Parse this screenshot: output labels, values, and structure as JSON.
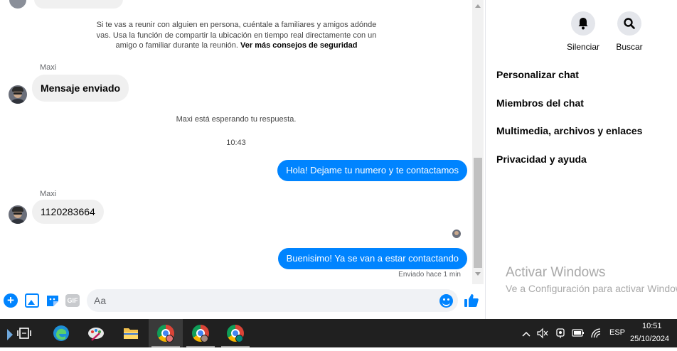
{
  "chat": {
    "safety_notice": "Si te vas a reunir con alguien en persona, cuéntale a familiares y amigos adónde vas. Usa la función de compartir la ubicación en tiempo real directamente con un amigo o familiar durante la reunión.",
    "safety_link": "Ver más consejos de seguridad",
    "messages": [
      {
        "sender": "Maxi",
        "text": "Mensaje enviado"
      },
      {
        "system": "Maxi está esperando tu respuesta."
      },
      {
        "time": "10:43"
      },
      {
        "outgoing": "Hola! Dejame tu numero y te contactamos"
      },
      {
        "sender": "Maxi",
        "text": "1120283664"
      },
      {
        "outgoing": "Buenisimo! Ya se van a estar contactando"
      }
    ],
    "sent_status": "Enviado hace 1 min"
  },
  "composer": {
    "placeholder": "Aa",
    "gif_label": "GIF"
  },
  "panel": {
    "buttons": [
      {
        "label": "Silenciar",
        "icon": "bell-icon"
      },
      {
        "label": "Buscar",
        "icon": "search-icon"
      }
    ],
    "menu": [
      "Personalizar chat",
      "Miembros del chat",
      "Multimedia, archivos y enlaces",
      "Privacidad y ayuda"
    ]
  },
  "watermark": {
    "title": "Activar Windows",
    "subtitle": "Ve a Configuración para activar Windows."
  },
  "taskbar": {
    "language": "ESP",
    "time": "10:51",
    "date": "25/10/2024"
  },
  "colors": {
    "accent": "#0084ff",
    "bubble_in": "#f0f0f0",
    "taskbar": "#202020"
  }
}
